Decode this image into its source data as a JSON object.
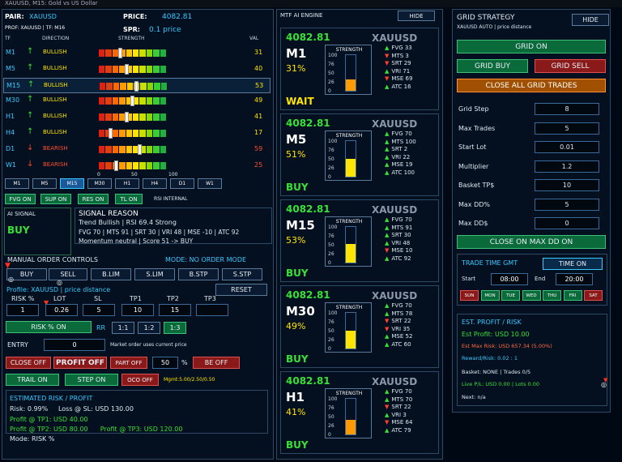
{
  "window_title": "XAUUSD, M15: Gold vs US Dollar",
  "info": {
    "pair_label": "PAIR:",
    "pair": "XAUUSD",
    "price_label": "PRICE:",
    "price": "4082.81",
    "prof": "PROF: XAUUSD | TF: M16",
    "spr_label": "SPR:",
    "spr": "0.1 price"
  },
  "trend_table": {
    "headers": [
      "TF",
      "DIRECTION",
      "STRENGTH",
      "VAL"
    ],
    "rows": [
      {
        "tf": "M1",
        "arrow": "↑",
        "dir": "BULLISH",
        "val": "31",
        "bull": true,
        "level": 0.31
      },
      {
        "tf": "M5",
        "arrow": "↑",
        "dir": "BULLISH",
        "val": "40",
        "bull": true,
        "level": 0.4
      },
      {
        "tf": "M15",
        "arrow": "↑",
        "dir": "BULLISH",
        "val": "53",
        "bull": true,
        "level": 0.53
      },
      {
        "tf": "M30",
        "arrow": "↑",
        "dir": "BULLISH",
        "val": "49",
        "bull": true,
        "level": 0.49
      },
      {
        "tf": "H1",
        "arrow": "↑",
        "dir": "BULLISH",
        "val": "41",
        "bull": true,
        "level": 0.41
      },
      {
        "tf": "H4",
        "arrow": "↑",
        "dir": "BULLISH",
        "val": "17",
        "bull": true,
        "level": 0.17
      },
      {
        "tf": "D1",
        "arrow": "↓",
        "dir": "BEARISH",
        "val": "59",
        "bull": false,
        "level": 0.59
      },
      {
        "tf": "W1",
        "arrow": "↓",
        "dir": "BEARISH",
        "val": "25",
        "bull": false,
        "level": 0.25
      }
    ],
    "scale": [
      "0",
      "50",
      "100"
    ]
  },
  "tf_buttons": [
    "M1",
    "M5",
    "M15",
    "M30",
    "H1",
    "H4",
    "D1",
    "W1"
  ],
  "filters": {
    "b1": "FVG ON",
    "b2": "SUP ON",
    "b3": "RES ON",
    "b4": "TL ON",
    "rsi": "RSI INTERNAL"
  },
  "signal": {
    "title": "AI SIGNAL",
    "value": "BUY"
  },
  "reason": {
    "title": "SIGNAL REASON",
    "l1": "Trend Bullish | RSI 69.4 Strong",
    "l2": "FVG 70 | MTS 91 | SRT 30 | VRI 48 | MSE -10 | ATC 92",
    "l3": "Momentum neutral | Score 51 -> BUY"
  },
  "manual": {
    "title": "MANUAL ORDER CONTROLS",
    "mode": "MODE: NO ORDER MODE",
    "buy": "BUY",
    "sell": "SELL",
    "blim": "B.LIM",
    "slim": "S.LIM",
    "bstp": "B.STP",
    "sstp": "S.STP",
    "profile": "Profile: XAUUSD | price distance",
    "reset": "RESET",
    "labels": [
      "RISK %",
      "LOT",
      "SL",
      "TP1",
      "TP2",
      "TP3"
    ],
    "values": [
      "1",
      "0.26",
      "5",
      "10",
      "15"
    ],
    "risk_on": "RISK % ON",
    "rr": "RR",
    "rr1": "1:1",
    "rr2": "1:2",
    "rr3": "1:3",
    "entry": "ENTRY",
    "entry_val": "0",
    "entry_note": "Market order uses current price",
    "close_off": "CLOSE OFF",
    "profit_off": "PROFIT OFF",
    "part_off": "PART OFF",
    "part_val": "50",
    "pct": "%",
    "be_off": "BE OFF",
    "trail_on": "TRAIL ON",
    "step_on": "STEP ON",
    "oco_off": "OCO OFF",
    "mgmt": "Mgmt:5.00/2.50/0.50"
  },
  "risk": {
    "title": "ESTIMATED RISK / PROFIT",
    "l1": "Risk: 0.99%     Loss @ SL: USD 130.00",
    "l2": "Profit @ TP1: USD 40.00",
    "l3": "Profit @ TP2: USD 80.00      Profit @ TP3: USD 120.00",
    "mode": "Mode: RISK %"
  },
  "mtf": {
    "title": "MTF AI ENGINE",
    "hide": "HIDE",
    "cards": [
      {
        "price": "4082.81",
        "sym": "XAUUSD",
        "tf": "M1",
        "pct": "31%",
        "signal": "WAIT",
        "sigcolor": "#ffe400",
        "strength": 0.31,
        "fill": "#ff9a00",
        "ind": [
          [
            "▲",
            "FVG 33"
          ],
          [
            "▼",
            "MTS 3"
          ],
          [
            "▼",
            "SRT 29"
          ],
          [
            "▲",
            "VRI 71"
          ],
          [
            "▼",
            "MSE 69"
          ],
          [
            "▲",
            "ATC 16"
          ]
        ]
      },
      {
        "price": "4082.81",
        "sym": "XAUUSD",
        "tf": "M5",
        "pct": "51%",
        "signal": "BUY",
        "sigcolor": "#38e038",
        "strength": 0.51,
        "fill": "#ffe400",
        "ind": [
          [
            "▲",
            "FVG 70"
          ],
          [
            "▲",
            "MTS 100"
          ],
          [
            "▲",
            "SRT 2"
          ],
          [
            "▲",
            "VRI 22"
          ],
          [
            "▲",
            "MSE 19"
          ],
          [
            "▲",
            "ATC 100"
          ]
        ]
      },
      {
        "price": "4082.81",
        "sym": "XAUUSD",
        "tf": "M15",
        "pct": "53%",
        "signal": "BUY",
        "sigcolor": "#38e038",
        "strength": 0.53,
        "fill": "#ffe400",
        "ind": [
          [
            "▲",
            "FVG 70"
          ],
          [
            "▲",
            "MTS 91"
          ],
          [
            "▲",
            "SRT 30"
          ],
          [
            "▲",
            "VRI 48"
          ],
          [
            "▼",
            "MSE 10"
          ],
          [
            "▲",
            "ATC 92"
          ]
        ]
      },
      {
        "price": "4082.81",
        "sym": "XAUUSD",
        "tf": "M30",
        "pct": "49%",
        "signal": "BUY",
        "sigcolor": "#38e038",
        "strength": 0.49,
        "fill": "#ffe400",
        "ind": [
          [
            "▲",
            "FVG 70"
          ],
          [
            "▲",
            "MTS 78"
          ],
          [
            "▼",
            "SRT 22"
          ],
          [
            "▼",
            "VRI 35"
          ],
          [
            "▲",
            "MSE 52"
          ],
          [
            "▲",
            "ATC 60"
          ]
        ]
      },
      {
        "price": "4082.81",
        "sym": "XAUUSD",
        "tf": "H1",
        "pct": "41%",
        "signal": "BUY",
        "sigcolor": "#38e038",
        "strength": 0.41,
        "fill": "#ff9a00",
        "ind": [
          [
            "▲",
            "FVG 70"
          ],
          [
            "▲",
            "MTS 70"
          ],
          [
            "▼",
            "SRT 22"
          ],
          [
            "▲",
            "VRI 3"
          ],
          [
            "▼",
            "MSE 64"
          ],
          [
            "▲",
            "ATC 79"
          ]
        ]
      }
    ],
    "axis": [
      "100",
      "76",
      "50",
      "26",
      "0"
    ],
    "strength_label": "STRENGTH"
  },
  "grid": {
    "title": "GRID STRATEGY",
    "sub": "XAUUSD AUTO | price distance",
    "hide": "HIDE",
    "grid_on": "GRID ON",
    "grid_buy": "GRID BUY",
    "grid_sell": "GRID SELL",
    "close_all": "CLOSE ALL GRID TRADES",
    "fields": [
      {
        "label": "Grid Step",
        "value": "8"
      },
      {
        "label": "Max Trades",
        "value": "5"
      },
      {
        "label": "Start Lot",
        "value": "0.01"
      },
      {
        "label": "Multiplier",
        "value": "1.2"
      },
      {
        "label": "Basket TP$",
        "value": "10"
      },
      {
        "label": "Max DD%",
        "value": "5"
      },
      {
        "label": "Max DD$",
        "value": "0"
      }
    ],
    "close_dd": "CLOSE ON MAX DD ON"
  },
  "time": {
    "title": "TRADE TIME GMT",
    "toggle": "TIME ON",
    "start_label": "Start",
    "start": "08:00",
    "end_label": "End",
    "end": "20:00",
    "days": [
      "SUN",
      "MON",
      "TUE",
      "WED",
      "THU",
      "FRI",
      "SAT"
    ]
  },
  "est": {
    "title": "EST. PROFIT / RISK",
    "profit": "Est Profit: USD 10.00",
    "maxrisk": "Est Max Risk: USD 657.34 (5.00%)",
    "rr": "Reward/Risk: 0.02 : 1",
    "basket": "Basket: NONE | Trades 0/5",
    "live": "Live P/L: USD 0.00 | Lots 0.00",
    "next": "Next: n/a"
  }
}
